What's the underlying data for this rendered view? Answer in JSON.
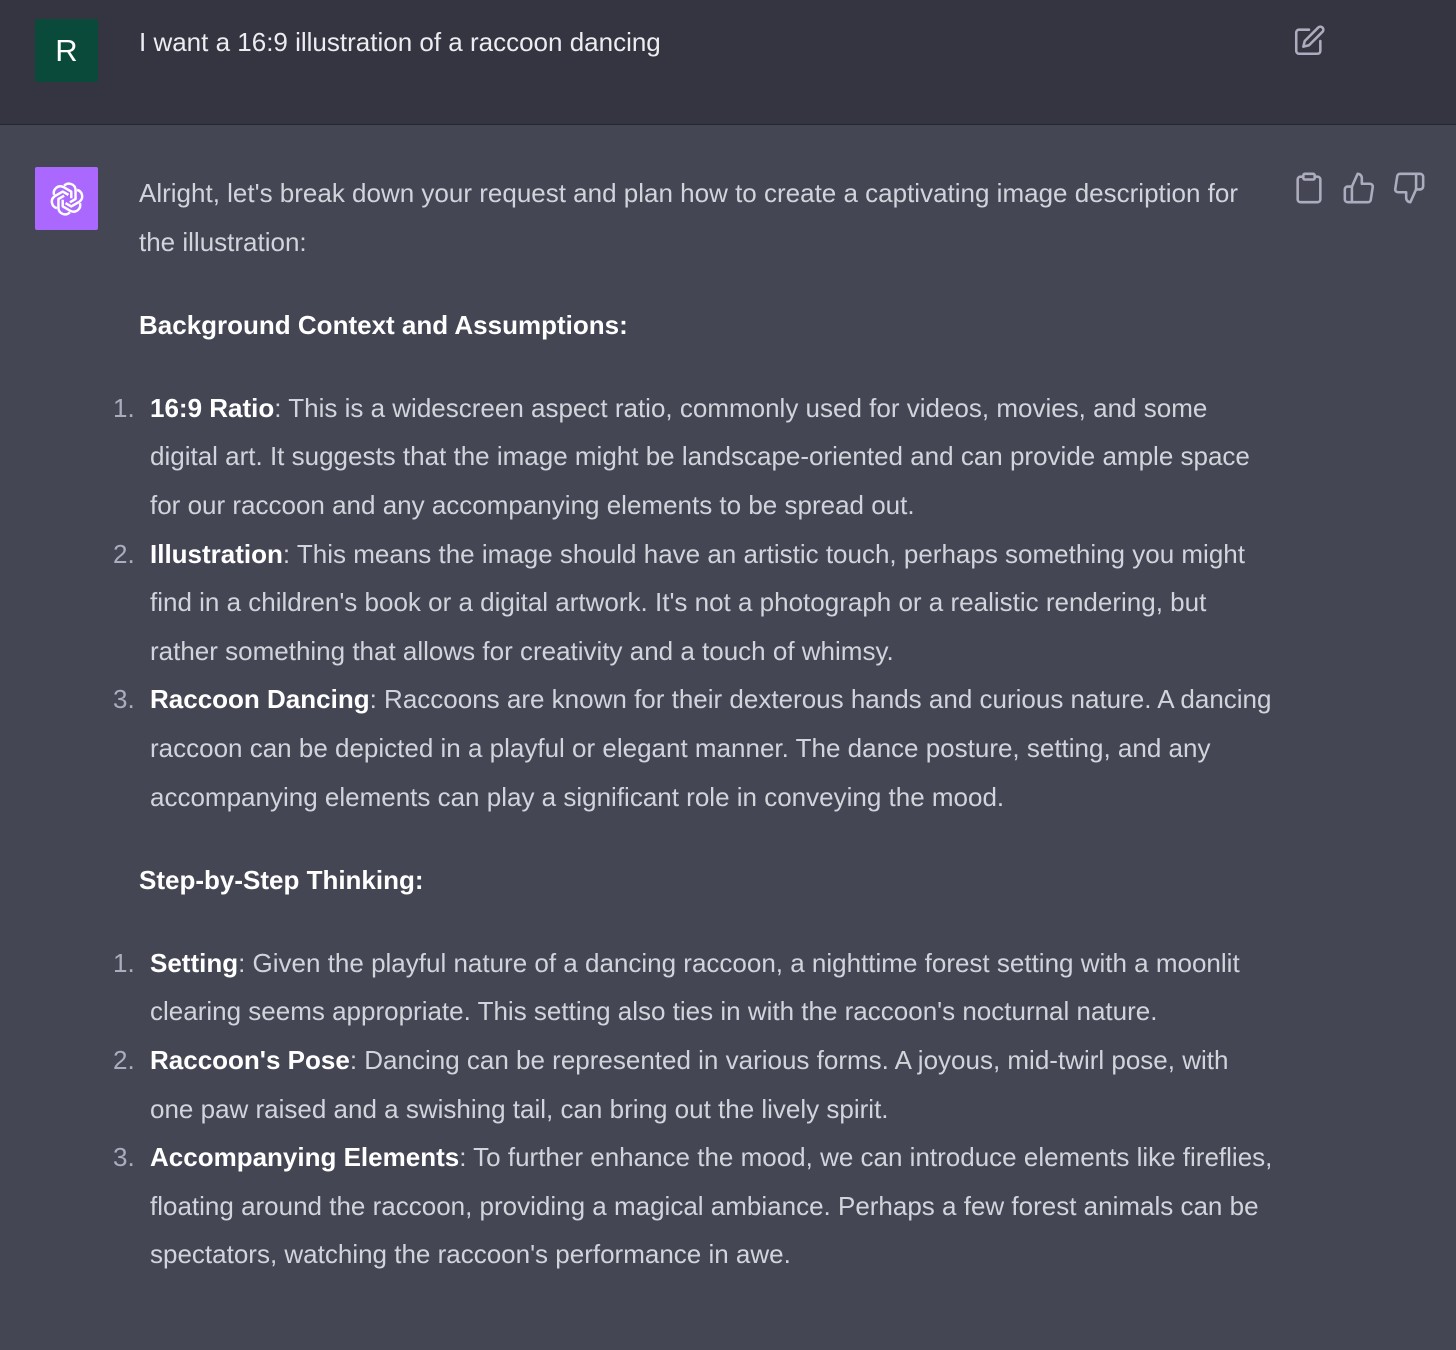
{
  "user": {
    "avatar_letter": "R",
    "message": "I want a 16:9 illustration of a raccoon dancing"
  },
  "assistant": {
    "intro": "Alright, let's break down your request and plan how to create a captivating image description for the illustration:",
    "section1": {
      "heading": "Background Context and Assumptions:",
      "items": [
        {
          "num": "1.",
          "term": "16:9 Ratio",
          "text": ": This is a widescreen aspect ratio, commonly used for videos, movies, and some digital art. It suggests that the image might be landscape-oriented and can provide ample space for our raccoon and any accompanying elements to be spread out."
        },
        {
          "num": "2.",
          "term": "Illustration",
          "text": ": This means the image should have an artistic touch, perhaps something you might find in a children's book or a digital artwork. It's not a photograph or a realistic rendering, but rather something that allows for creativity and a touch of whimsy."
        },
        {
          "num": "3.",
          "term": "Raccoon Dancing",
          "text": ": Raccoons are known for their dexterous hands and curious nature. A dancing raccoon can be depicted in a playful or elegant manner. The dance posture, setting, and any accompanying elements can play a significant role in conveying the mood."
        }
      ]
    },
    "section2": {
      "heading": "Step-by-Step Thinking:",
      "items": [
        {
          "num": "1.",
          "term": "Setting",
          "text": ": Given the playful nature of a dancing raccoon, a nighttime forest setting with a moonlit clearing seems appropriate. This setting also ties in with the raccoon's nocturnal nature."
        },
        {
          "num": "2.",
          "term": "Raccoon's Pose",
          "text": ": Dancing can be represented in various forms. A joyous, mid-twirl pose, with one paw raised and a swishing tail, can bring out the lively spirit."
        },
        {
          "num": "3.",
          "term": "Accompanying Elements",
          "text": ": To further enhance the mood, we can introduce elements like fireflies, floating around the raccoon, providing a magical ambiance. Perhaps a few forest animals can be spectators, watching the raccoon's performance in awe."
        }
      ]
    }
  },
  "icons": {
    "edit": "edit-icon",
    "copy": "clipboard-icon",
    "like": "thumbs-up-icon",
    "dislike": "thumbs-down-icon",
    "assistant_logo": "openai-logo-icon"
  },
  "colors": {
    "user_bg": "#343541",
    "assistant_bg": "#444654",
    "user_avatar": "#0a4a3a",
    "assistant_avatar": "#ab68ff"
  }
}
